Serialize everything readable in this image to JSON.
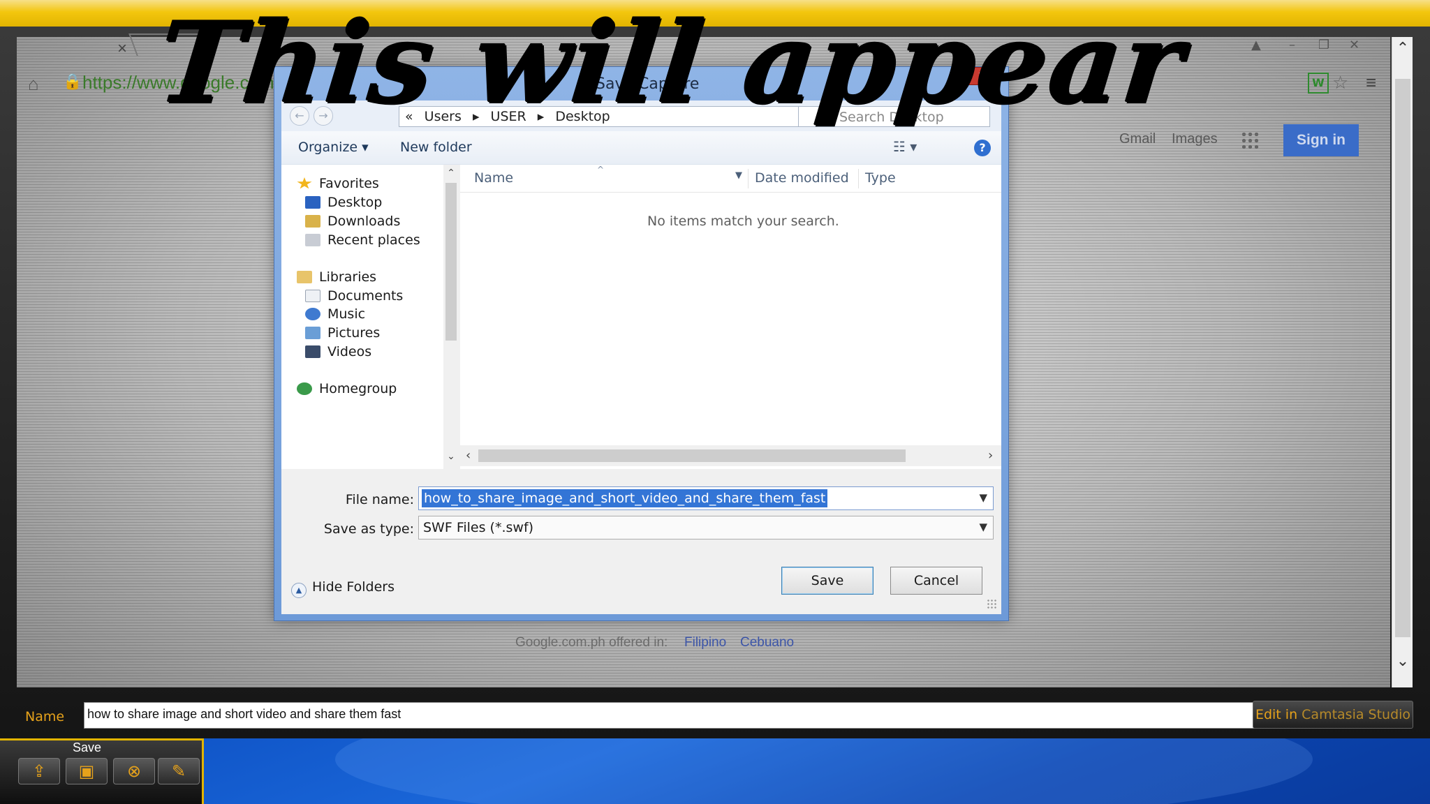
{
  "background_browser": {
    "tab_close": "×",
    "url": "https://www.google.com.ph",
    "gmail": "Gmail",
    "images": "Images",
    "sign_in": "Sign in",
    "footer_text": "Google.com.ph offered in:",
    "footer_lang_1": "Filipino",
    "footer_lang_2": "Cebuano"
  },
  "dialog": {
    "title": "Save Capture",
    "breadcrumb": [
      "Users",
      "USER",
      "Desktop"
    ],
    "breadcrumb_prefix": "«",
    "search_placeholder": "Search Desktop",
    "toolbar": {
      "organize": "Organize ▾",
      "new_folder": "New folder"
    },
    "nav": {
      "favorites": "Favorites",
      "desktop": "Desktop",
      "downloads": "Downloads",
      "recent_places": "Recent places",
      "libraries": "Libraries",
      "documents": "Documents",
      "music": "Music",
      "pictures": "Pictures",
      "videos": "Videos",
      "homegroup": "Homegroup"
    },
    "columns": {
      "name": "Name",
      "date_modified": "Date modified",
      "type": "Type"
    },
    "empty_message": "No items match your search.",
    "file_name_label": "File name:",
    "file_name_value": "how_to_share_image_and_short_video_and_share_them_fast",
    "save_as_type_label": "Save as type:",
    "save_as_type_value": "SWF Files (*.swf)",
    "hide_folders": "Hide Folders",
    "save_button": "Save",
    "cancel_button": "Cancel"
  },
  "overlay_text": "This will appear",
  "name_bar": {
    "label": "Name",
    "value": "how to share image and short video and share them fast",
    "edit_prefix": "Edit in ",
    "edit_app": "Camtasia Studio"
  },
  "save_panel": {
    "label": "Save"
  },
  "colors": {
    "accent_yellow": "#f3c60e",
    "label_orange": "#e6a21b",
    "dialog_frame": "#7fa6de",
    "selection_blue": "#3375d6"
  }
}
